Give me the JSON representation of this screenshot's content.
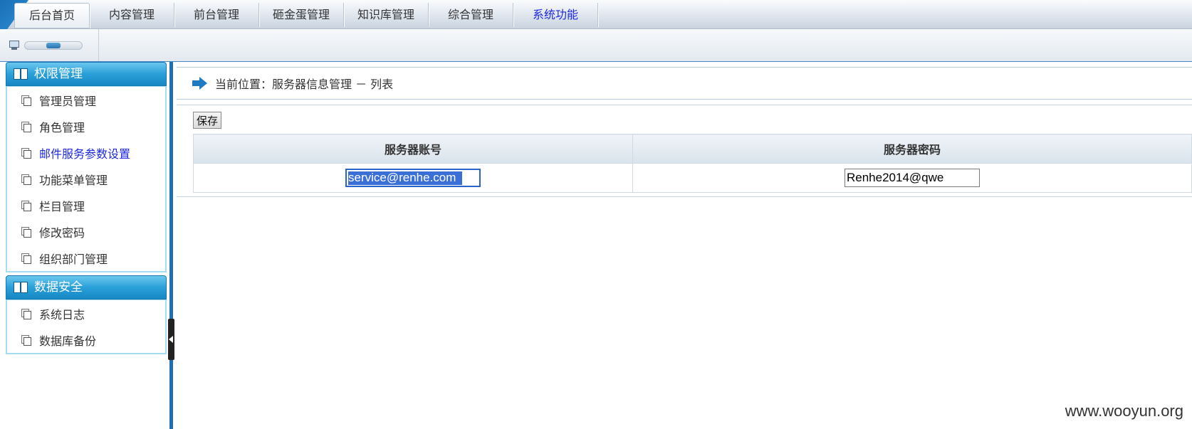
{
  "topnav": {
    "tabs": [
      {
        "label": "后台首页"
      },
      {
        "label": "内容管理"
      },
      {
        "label": "前台管理"
      },
      {
        "label": "砸金蛋管理"
      },
      {
        "label": "知识库管理"
      },
      {
        "label": "综合管理"
      },
      {
        "label": "系统功能"
      }
    ],
    "active_tab": "系统功能"
  },
  "sidebar": {
    "groups": [
      {
        "title": "权限管理",
        "items": [
          "管理员管理",
          "角色管理",
          "邮件服务参数设置",
          "功能菜单管理",
          "栏目管理",
          "修改密码",
          "组织部门管理"
        ]
      },
      {
        "title": "数据安全",
        "items": [
          "系统日志",
          "数据库备份"
        ]
      }
    ],
    "active_item": "邮件服务参数设置"
  },
  "main": {
    "location": "当前位置：服务器信息管理 － 列表",
    "save_label": "保存",
    "columns": [
      "服务器账号",
      "服务器密码"
    ],
    "row": {
      "account": "service@renhe.com",
      "password": "Renhe2014@qwe"
    }
  },
  "watermark": "www.wooyun.org",
  "colors": {
    "accent_blue": "#1f6fb3",
    "active_text": "#1c28e0",
    "group_header": "#2aa0d8"
  }
}
